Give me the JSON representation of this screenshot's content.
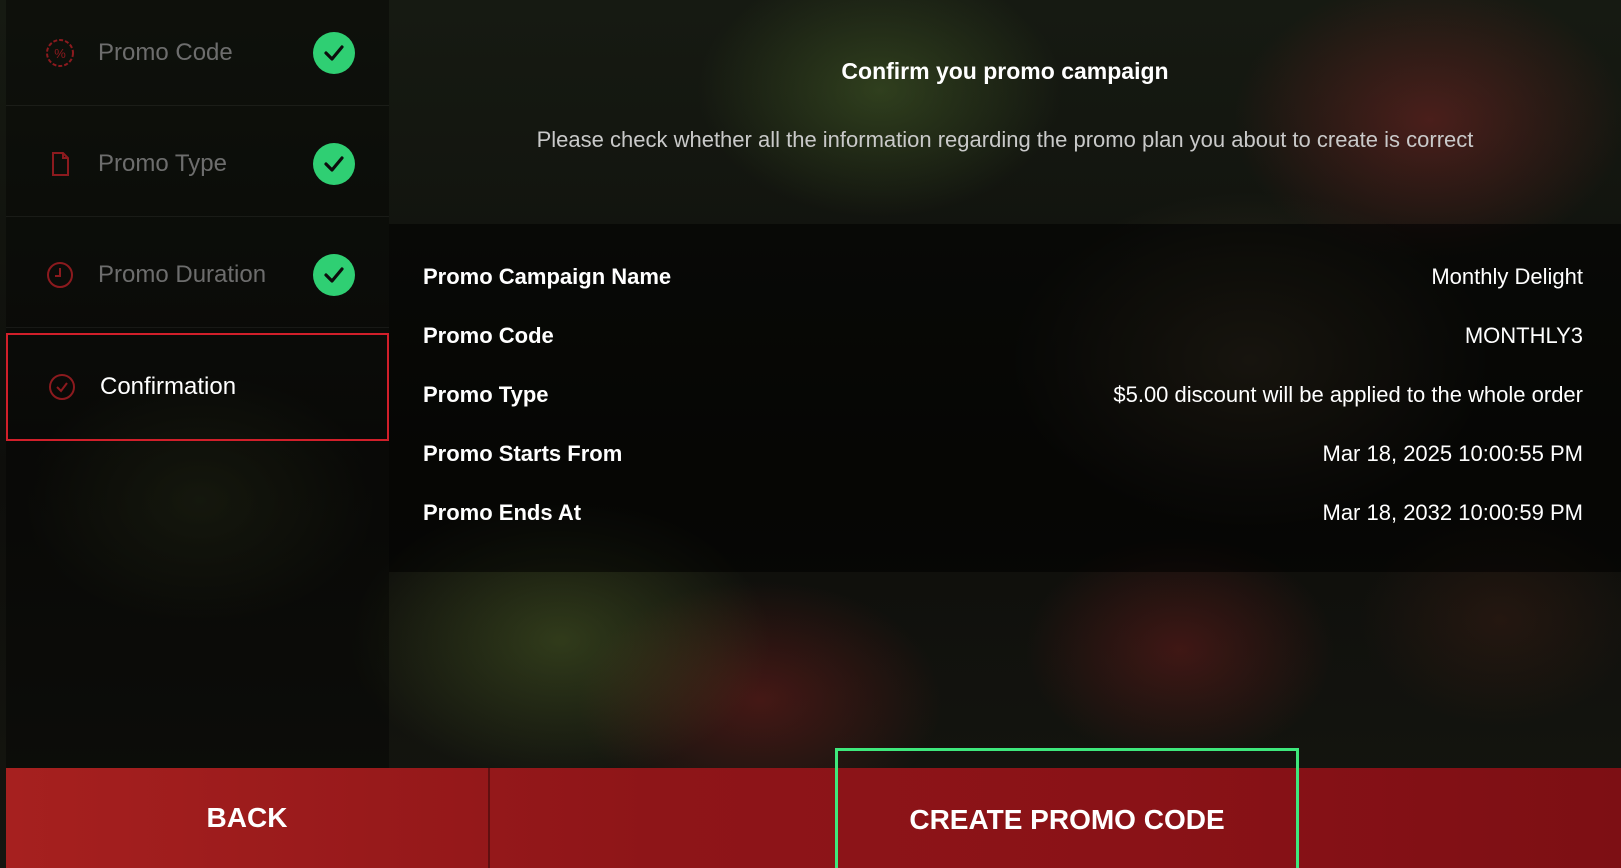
{
  "sidebar": {
    "steps": [
      {
        "label": "Promo Code",
        "icon": "percent-badge-icon",
        "done": true
      },
      {
        "label": "Promo Type",
        "icon": "document-icon",
        "done": true
      },
      {
        "label": "Promo Duration",
        "icon": "clock-icon",
        "done": true
      },
      {
        "label": "Confirmation",
        "icon": "check-circle-icon",
        "done": false
      }
    ]
  },
  "header": {
    "title": "Confirm you promo campaign",
    "subtitle": "Please check whether all the information regarding the promo plan you about to create is correct"
  },
  "summary": {
    "rows": [
      {
        "key": "Promo Campaign Name",
        "value": "Monthly Delight"
      },
      {
        "key": "Promo Code",
        "value": "MONTHLY3"
      },
      {
        "key": "Promo Type",
        "value": "$5.00 discount will be applied to the whole order"
      },
      {
        "key": "Promo Starts From",
        "value": "Mar 18, 2025 10:00:55 PM"
      },
      {
        "key": "Promo Ends At",
        "value": "Mar 18, 2032 10:00:59 PM"
      }
    ]
  },
  "actions": {
    "back_label": "BACK",
    "create_label": "CREATE PROMO CODE"
  },
  "colors": {
    "accent_red": "#d11f2a",
    "success_green": "#2fcf73",
    "highlight_green": "#3ee87c",
    "bar_red": "#8e1518"
  }
}
